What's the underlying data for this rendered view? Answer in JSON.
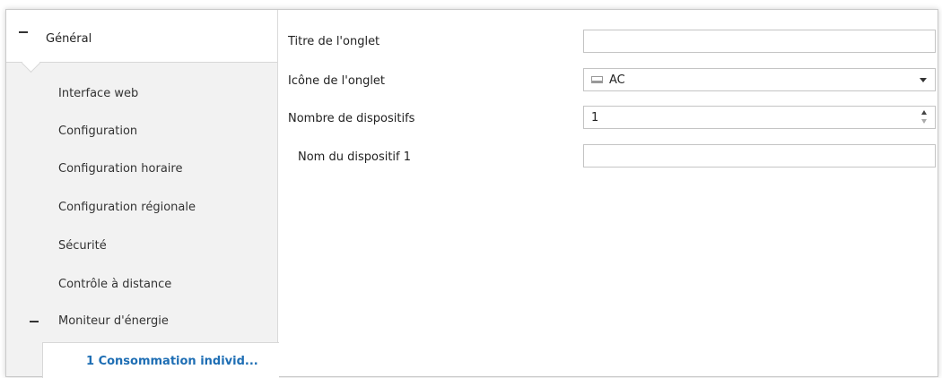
{
  "sidebar": {
    "group": {
      "label": "Général"
    },
    "items": [
      {
        "label": "Interface web"
      },
      {
        "label": "Configuration"
      },
      {
        "label": "Configuration horaire"
      },
      {
        "label": "Configuration régionale"
      },
      {
        "label": "Sécurité"
      },
      {
        "label": "Contrôle à distance"
      }
    ],
    "subgroup": {
      "label": "Moniteur d'énergie"
    },
    "selected_item": {
      "label": "1 Consommation individ..."
    }
  },
  "form": {
    "tab_title": {
      "label": "Titre de l'onglet",
      "value": ""
    },
    "tab_icon": {
      "label": "Icône de l'onglet",
      "value": "AC",
      "icon": "ac-unit-icon"
    },
    "device_count": {
      "label": "Nombre de dispositifs",
      "value": "1"
    },
    "device_name_1": {
      "label": "Nom du dispositif 1",
      "value": ""
    }
  },
  "colors": {
    "accent": "#1e6eb4",
    "sidebar_bg": "#f2f2f2"
  }
}
